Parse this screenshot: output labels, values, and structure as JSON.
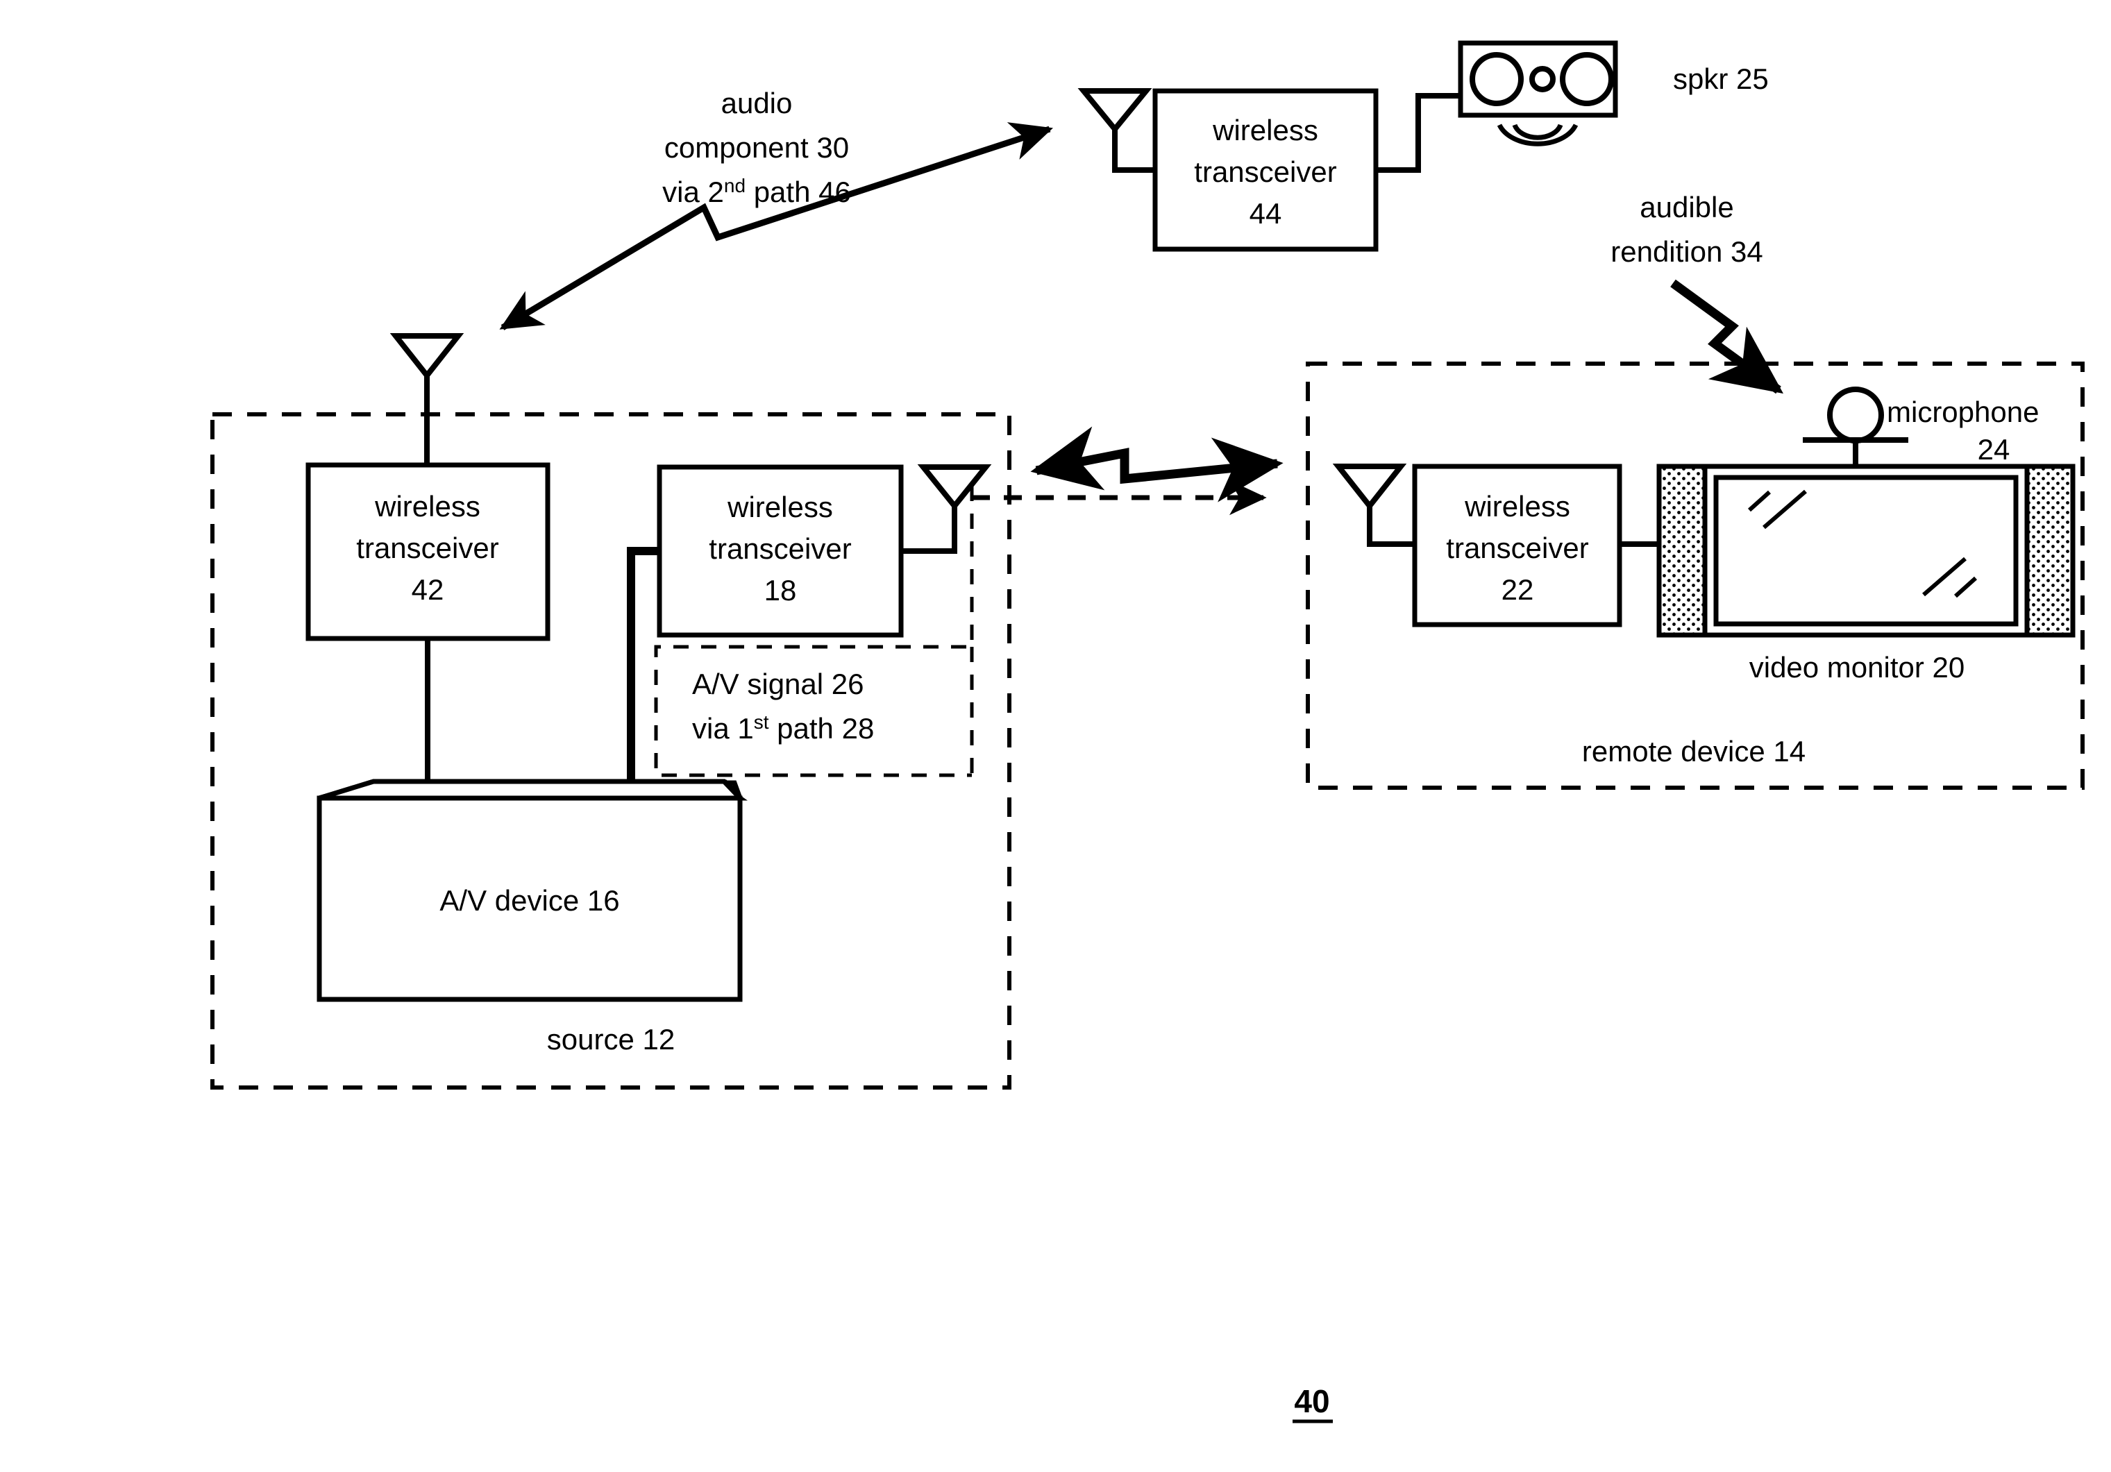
{
  "figure": {
    "number": "40",
    "number_underline": true
  },
  "labels": {
    "audio_path": {
      "line1": "audio",
      "line2": "component 30",
      "line3_pre": "via 2",
      "line3_sup": "nd",
      "line3_post": " path 46"
    },
    "av_signal": {
      "line1": "A/V signal 26",
      "line2_pre": "via 1",
      "line2_sup": "st",
      "line2_post": " path 28"
    },
    "audible_rendition": {
      "line1": "audible",
      "line2": "rendition 34"
    },
    "speaker": "spkr 25",
    "microphone": {
      "line1": "microphone",
      "line2": "24"
    },
    "video_monitor": "video monitor 20",
    "source_enclosure": "source 12",
    "remote_enclosure": "remote device 14"
  },
  "blocks": [
    {
      "id": "transceiver-44",
      "line1": "wireless",
      "line2": "transceiver",
      "line3": "44"
    },
    {
      "id": "transceiver-42",
      "line1": "wireless",
      "line2": "transceiver",
      "line3": "42"
    },
    {
      "id": "transceiver-18",
      "line1": "wireless",
      "line2": "transceiver",
      "line3": "18"
    },
    {
      "id": "transceiver-22",
      "line1": "wireless",
      "line2": "transceiver",
      "line3": "22"
    },
    {
      "id": "av-device-16",
      "line1": "A/V device 16"
    }
  ],
  "icons": {
    "antenna": "antenna-icon",
    "speaker": "speaker-icon",
    "microphone": "microphone-icon",
    "monitor": "video-monitor-icon",
    "sound_waves": "sound-waves-icon",
    "lightning_arrow": "lightning-arrow-icon"
  },
  "colors": {
    "ink": "#000000",
    "paper": "#ffffff"
  }
}
